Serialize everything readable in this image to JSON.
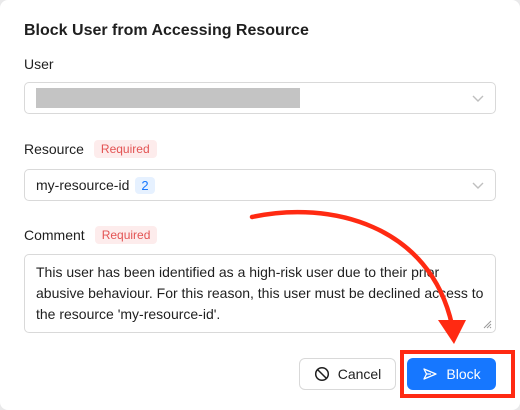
{
  "dialog": {
    "title": "Block User from Accessing Resource"
  },
  "fields": {
    "user": {
      "label": "User",
      "value_redacted": true
    },
    "resource": {
      "label": "Resource",
      "required_badge": "Required",
      "value": "my-resource-id",
      "count": "2"
    },
    "comment": {
      "label": "Comment",
      "required_badge": "Required",
      "text": "This user has been identified as a high-risk user due to their prior abusive behaviour. For this reason, this user must be declined access to the resource 'my-resource-id'."
    }
  },
  "actions": {
    "cancel_label": "Cancel",
    "block_label": "Block"
  },
  "icons": {
    "dropdown": "chevron-down-icon",
    "cancel": "block-circle-icon",
    "block": "send-icon",
    "resize": "resize-handle-icon"
  },
  "colors": {
    "primary": "#1677ff",
    "required_text": "#e35353",
    "required_bg": "#fdecec",
    "annotation": "#ff2a12"
  }
}
